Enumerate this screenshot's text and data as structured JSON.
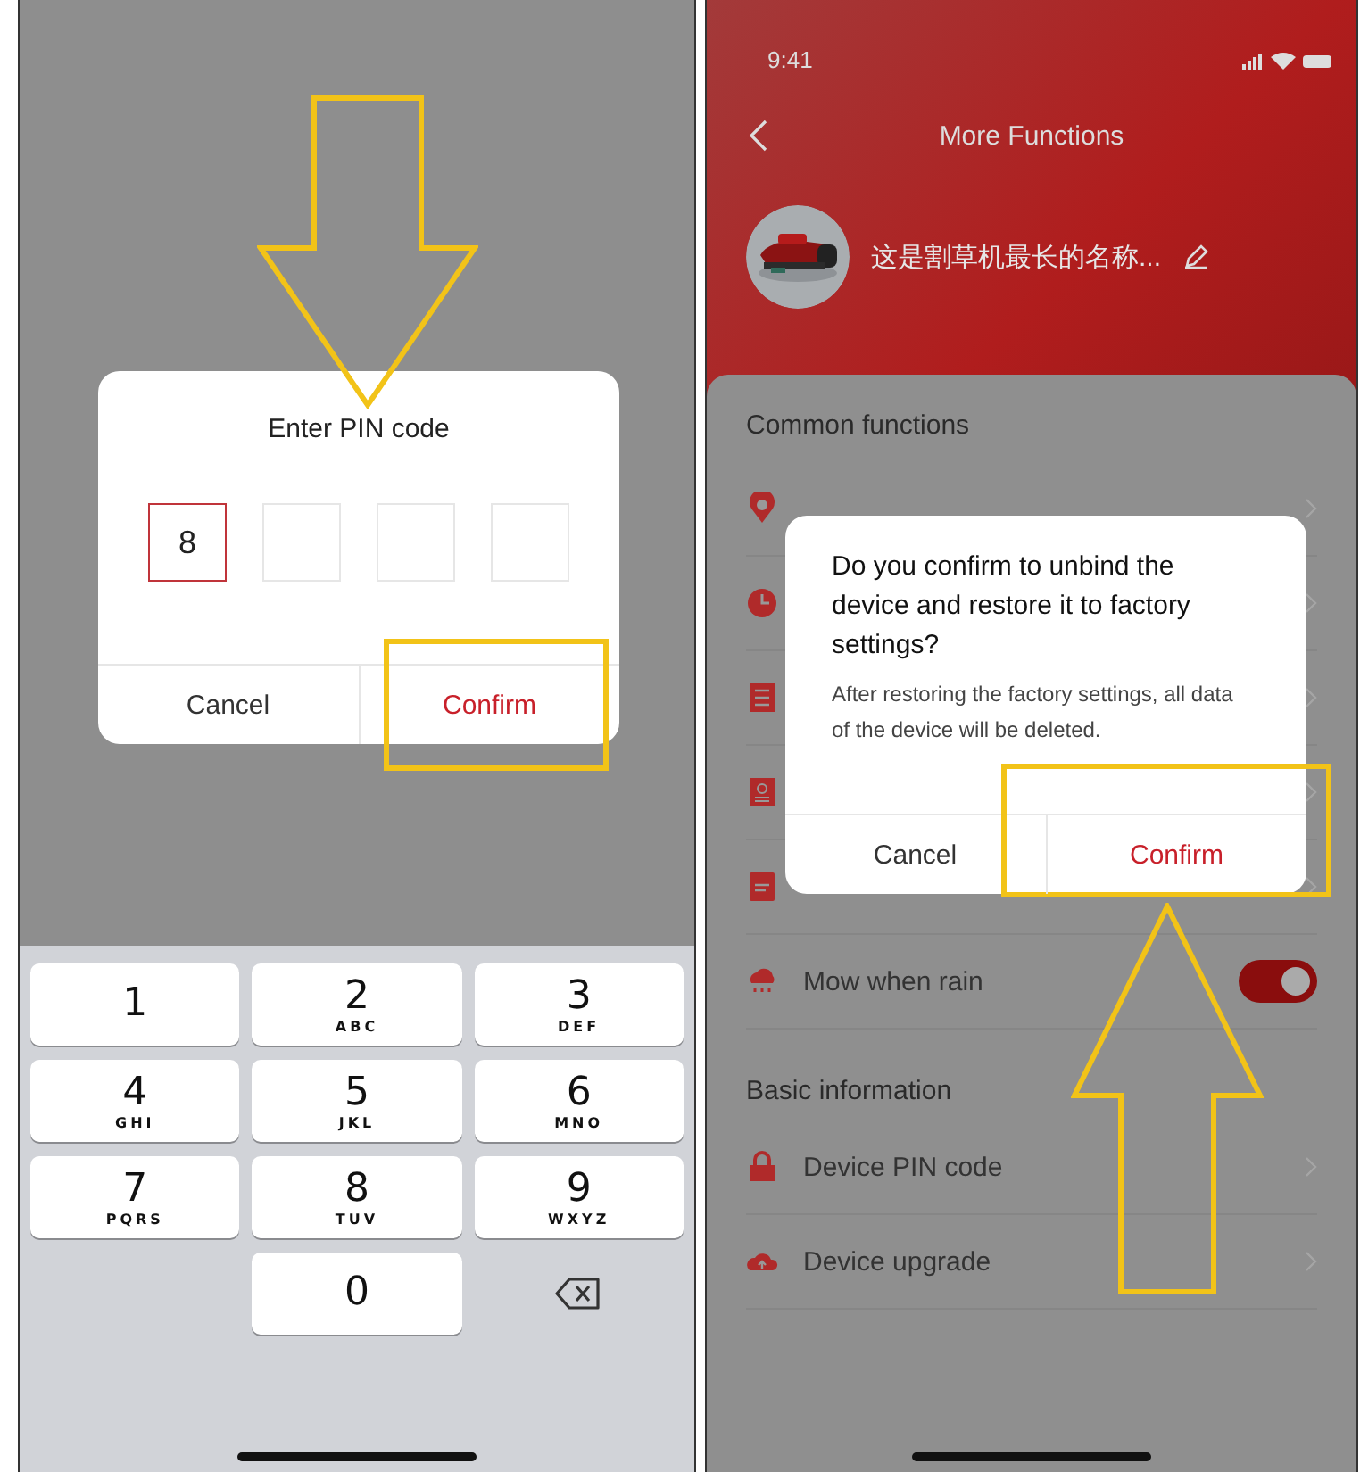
{
  "pin_screen": {
    "dialog": {
      "title": "Enter PIN code",
      "digit_boxes": [
        {
          "value": "8",
          "active": true
        },
        {
          "active": false
        },
        {
          "active": false
        },
        {
          "active": false
        }
      ],
      "buttons": [
        {
          "label": "Cancel",
          "kind": "cancel"
        },
        {
          "label": "Confirm",
          "kind": "confirm"
        }
      ]
    },
    "keypad": {
      "keys": [
        {
          "kind": "digit",
          "digit": "1"
        },
        {
          "kind": "digit",
          "digit": "2",
          "letters": "ABC"
        },
        {
          "kind": "digit",
          "digit": "3",
          "letters": "DEF"
        },
        {
          "kind": "digit",
          "digit": "4",
          "letters": "GHI"
        },
        {
          "kind": "digit",
          "digit": "5",
          "letters": "JKL"
        },
        {
          "kind": "digit",
          "digit": "6",
          "letters": "MNO"
        },
        {
          "kind": "digit",
          "digit": "7",
          "letters": "PQRS"
        },
        {
          "kind": "digit",
          "digit": "8",
          "letters": "TUV"
        },
        {
          "kind": "digit",
          "digit": "9",
          "letters": "WXYZ"
        },
        {
          "kind": "blank"
        },
        {
          "kind": "digit",
          "digit": "0"
        },
        {
          "kind": "backspace"
        }
      ]
    }
  },
  "more_functions_screen": {
    "status_bar": {
      "time": "9:41"
    },
    "header": {
      "title": "More Functions"
    },
    "device": {
      "kind": "picture",
      "name": "这是割草机最长的名称..."
    },
    "common_functions": {
      "title": "Common functions",
      "items": [
        {
          "kind": "link"
        },
        {
          "kind": "link"
        },
        {
          "kind": "link"
        },
        {
          "kind": "link"
        },
        {
          "kind": "link"
        },
        {
          "kind": "toggle",
          "label": "Mow when rain",
          "on": true
        }
      ]
    },
    "basic_information": {
      "title": "Basic information",
      "items": [
        {
          "label": "Device PIN code"
        },
        {
          "label": "Device upgrade"
        }
      ]
    },
    "dialog": {
      "title": "Do you confirm to unbind the device and restore it to factory settings?",
      "message": "After restoring the factory settings, all data of the device will be deleted.",
      "buttons": [
        {
          "label": "Cancel",
          "kind": "cancel"
        },
        {
          "label": "Confirm",
          "kind": "confirm"
        }
      ]
    }
  }
}
